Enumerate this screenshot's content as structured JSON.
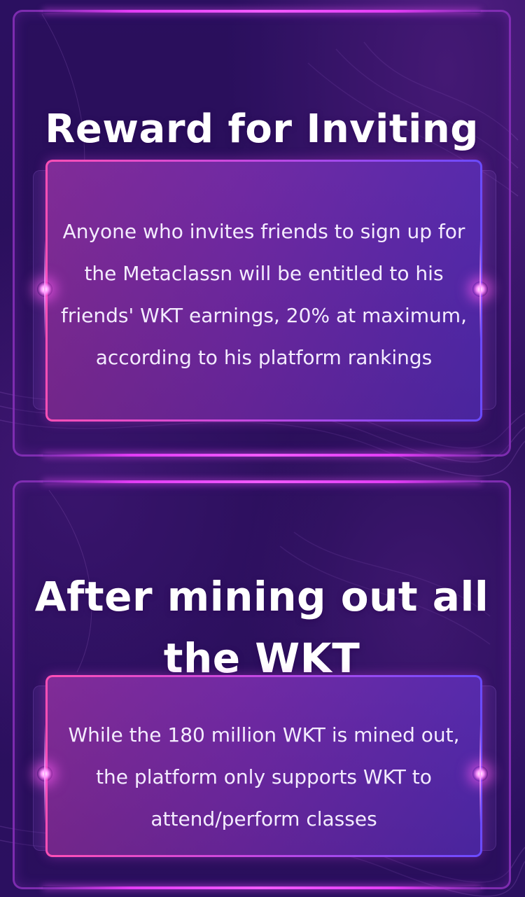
{
  "sections": [
    {
      "title": "Reward for Inviting",
      "body": "Anyone who invites friends to sign up for the Metaclassn will be entitled to his friends' WKT earnings, 20% at maximum, according to his platform rankings"
    },
    {
      "title": "After mining out all the WKT",
      "body": "While the 180 million WKT is mined out, the platform only supports WKT to attend/perform classes"
    }
  ],
  "colors": {
    "background": "#2a0f5c",
    "panel_border": "#8c32be",
    "glow_accent": "#e23cf5",
    "card_border_start": "#ff4fb5",
    "card_border_end": "#6a4bff",
    "text": "#ffffff"
  }
}
